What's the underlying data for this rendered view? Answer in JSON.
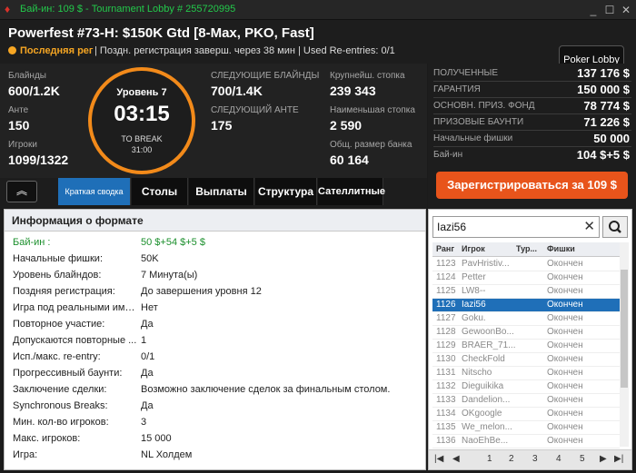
{
  "window": {
    "title": "Бай-ин: 109 $ - Tournament Lobby # 255720995",
    "app_icon": "spade-icon",
    "buttons": {
      "minimize": "_",
      "maximize": "☐",
      "close": "✕"
    }
  },
  "header": {
    "tournament_name": "Powerfest #73-H: $150K Gtd [8-Max, PKO, Fast]",
    "late_reg_label": "Последняя рег",
    "info": "| Поздн. регистрация заверш. через 38 мин  | Used Re-entries: 0/1",
    "lobby_button": "Poker Lobby"
  },
  "stats": {
    "blinds_label": "Блайнды",
    "blinds_value": "600/1.2K",
    "ante_label": "Анте",
    "ante_value": "150",
    "players_label": "Игроки",
    "players_value": "1099/1322",
    "next_blinds_label": "СЛЕДУЮЩИЕ БЛАЙНДЫ",
    "next_blinds_value": "700/1.4K",
    "next_ante_label": "СЛЕДУЮЩИЙ АНТЕ",
    "next_ante_value": "175",
    "largest_stack_label": "Крупнейш. стопка",
    "largest_stack_value": "239 343",
    "smallest_stack_label": "Наименьшая стопка",
    "smallest_stack_value": "2 590",
    "bank_label": "Общ. размер банка",
    "bank_value": "60 164"
  },
  "clock": {
    "level": "Уровень 7",
    "time": "03:15",
    "break_label": "TO BREAK",
    "break_time": "31:00",
    "accent": "#f28a1a"
  },
  "prize": {
    "rows": [
      {
        "label": "ПОЛУЧЕННЫЕ",
        "value": "137 176 $"
      },
      {
        "label": "ГАРАНТИЯ",
        "value": "150 000 $"
      },
      {
        "label": "ОСНОВН. ПРИЗ. ФОНД",
        "value": "78 774 $"
      },
      {
        "label": "ПРИЗОВЫЕ БАУНТИ",
        "value": "71 226 $"
      },
      {
        "label": "Начальные фишки",
        "value": "50 000"
      },
      {
        "label": "Бай-ин",
        "value": "104 $+5 $"
      }
    ],
    "register_button": "Зарегистрироваться за  109 $"
  },
  "tabs": [
    {
      "label": "Краткая сводка",
      "active": true
    },
    {
      "label": "Столы",
      "active": false
    },
    {
      "label": "Выплаты",
      "active": false
    },
    {
      "label": "Структура",
      "active": false
    },
    {
      "label": "Сателлитные",
      "active": false
    }
  ],
  "collapse_icon": "double-chevron-up-icon",
  "format": {
    "title": "Информация о формате",
    "rows": [
      {
        "key": "Бай-ин :",
        "value": "50 $+54 $+5 $",
        "highlight": true
      },
      {
        "key": "Начальные фишки:",
        "value": "50K"
      },
      {
        "key": "Уровень блайндов:",
        "value": "7 Минута(ы)"
      },
      {
        "key": "Поздняя регистрация:",
        "value": "До завершения уровня 12"
      },
      {
        "key": "Игра под реальными имен...",
        "value": "Нет"
      },
      {
        "key": "Повторное участие:",
        "value": "Да"
      },
      {
        "key": "Допускаются повторные ...",
        "value": "1"
      },
      {
        "key": "Исп./макс. re-entry:",
        "value": "0/1"
      },
      {
        "key": "Прогрессивный баунти:",
        "value": "Да"
      },
      {
        "key": "Заключение сделки:",
        "value": "Возможно заключение сделок за финальным столом."
      },
      {
        "key": "Synchronous Breaks:",
        "value": "Да"
      },
      {
        "key": "Мин. кол-во игроков:",
        "value": "3"
      },
      {
        "key": "Макс. игроков:",
        "value": "15 000"
      },
      {
        "key": "Игра:",
        "value": "NL Холдем"
      }
    ]
  },
  "players": {
    "search_value": "Iazi56",
    "columns": {
      "rank": "Ранг",
      "player": "Игрок",
      "tour": "Тур...",
      "chips": "Фишки"
    },
    "rows": [
      {
        "rank": "1123",
        "name": "PavHristiv...",
        "chips": "Окончен"
      },
      {
        "rank": "1124",
        "name": "Petter",
        "chips": "Окончен"
      },
      {
        "rank": "1125",
        "name": "LW8--",
        "chips": "Окончен"
      },
      {
        "rank": "1126",
        "name": "Iazi56",
        "chips": "Окончен",
        "selected": true
      },
      {
        "rank": "1127",
        "name": "Goku.",
        "chips": "Окончен"
      },
      {
        "rank": "1128",
        "name": "GewoonBo...",
        "chips": "Окончен"
      },
      {
        "rank": "1129",
        "name": "BRAER_71...",
        "chips": "Окончен"
      },
      {
        "rank": "1130",
        "name": "CheckFold",
        "chips": "Окончен"
      },
      {
        "rank": "1131",
        "name": "Nitscho",
        "chips": "Окончен"
      },
      {
        "rank": "1132",
        "name": "Dieguikika",
        "chips": "Окончен"
      },
      {
        "rank": "1133",
        "name": "Dandelion...",
        "chips": "Окончен"
      },
      {
        "rank": "1134",
        "name": "OKgoogle",
        "chips": "Окончен"
      },
      {
        "rank": "1135",
        "name": "We_melon...",
        "chips": "Окончен"
      },
      {
        "rank": "1136",
        "name": "NaoEhBe...",
        "chips": "Окончен"
      }
    ],
    "pages": [
      "1",
      "2",
      "3",
      "4",
      "5"
    ]
  }
}
